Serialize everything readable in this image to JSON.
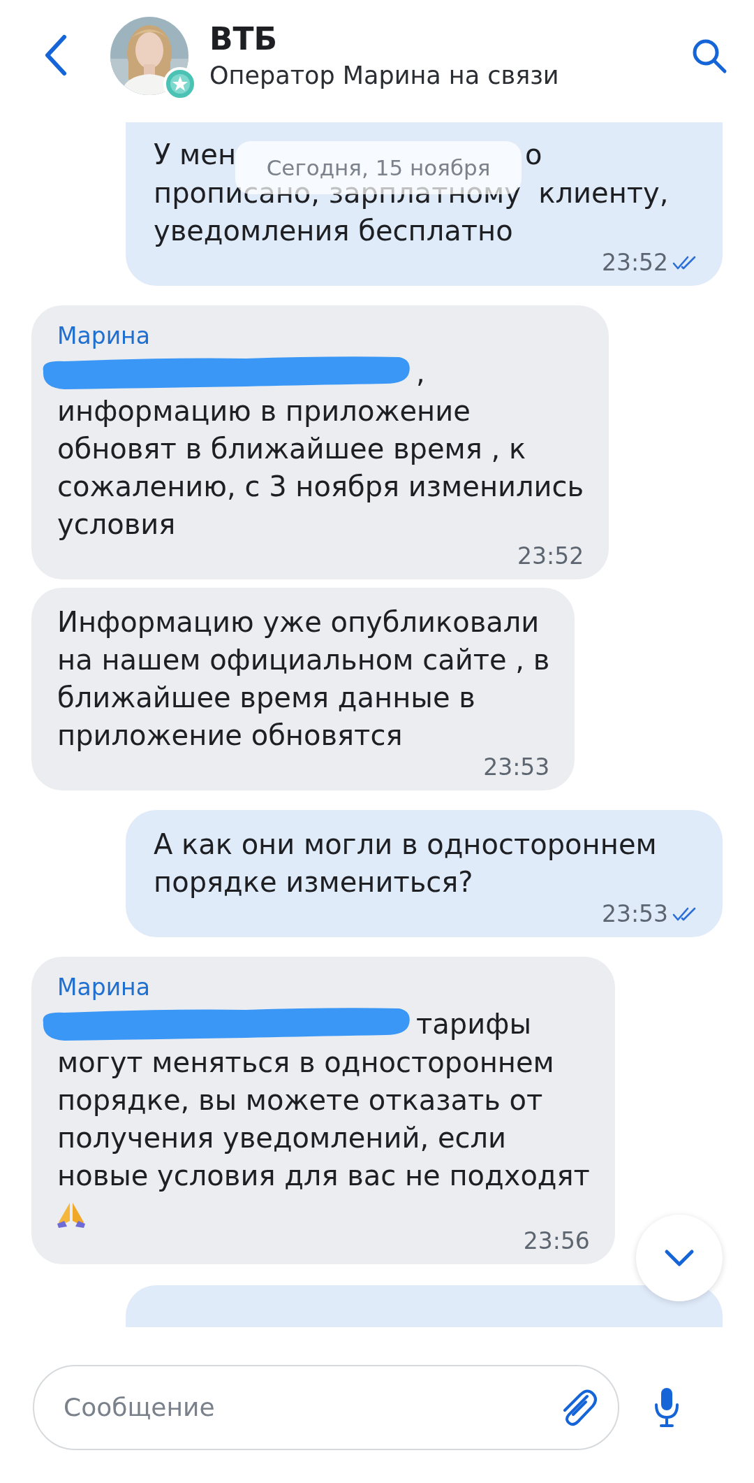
{
  "header": {
    "title": "ВТБ",
    "subtitle": "Оператор Марина на связи"
  },
  "date_pill": "Сегодня, 15 ноября",
  "messages": [
    {
      "kind": "outgoing",
      "covered_line": [
        "У мен",
        "о"
      ],
      "lines": [
        "прописано, зарплатному  клиенту,",
        "уведомления бесплатно"
      ],
      "time": "23:52",
      "read": true
    },
    {
      "kind": "incoming",
      "sender": "Марина",
      "redacted": true,
      "after_redaction": ",",
      "lines": [
        "информацию в приложение",
        "обновят в ближайшее время , к",
        "сожалению, с 3 ноября изменились",
        "условия"
      ],
      "time": "23:52"
    },
    {
      "kind": "incoming",
      "lines": [
        "Информацию уже опубликовали",
        "на нашем официальном сайте , в",
        "ближайшее время данные в",
        "приложение обновятся"
      ],
      "time": "23:53"
    },
    {
      "kind": "outgoing",
      "lines": [
        "А как они могли в одностороннем",
        "порядке измениться?"
      ],
      "time": "23:53",
      "read": true
    },
    {
      "kind": "incoming",
      "sender": "Марина",
      "redacted": true,
      "after_redaction": "тарифы",
      "lines": [
        "могут меняться в одностороннем",
        "порядке, вы можете отказать от",
        "получения уведомлений, если",
        "новые условия для вас не подходят"
      ],
      "praying_hands_icon": true,
      "time": "23:56"
    }
  ],
  "composer": {
    "placeholder": "Сообщение"
  }
}
